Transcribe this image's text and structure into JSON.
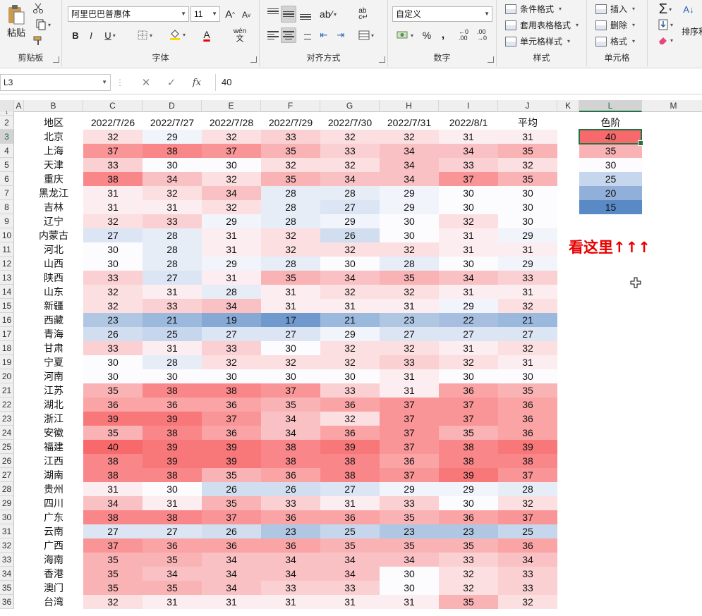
{
  "ribbon": {
    "clipboard": {
      "paste_label": "粘贴",
      "group_label": "剪贴板"
    },
    "font": {
      "name": "阿里巴巴普惠体",
      "size": "11",
      "group_label": "字体",
      "bold": "B",
      "italic": "I",
      "underline": "U",
      "grow": "A",
      "shrink": "A",
      "font_color": "A",
      "phonetic": "wén"
    },
    "alignment": {
      "group_label": "对齐方式"
    },
    "number": {
      "format": "自定义",
      "group_label": "数字",
      "percent": "%",
      "comma": ","
    },
    "styles": {
      "group_label": "样式",
      "items": [
        "条件格式",
        "套用表格格式",
        "单元格样式"
      ]
    },
    "cells": {
      "group_label": "单元格",
      "items": [
        "插入",
        "删除",
        "格式"
      ]
    },
    "editing": {
      "sort_label": "排序和"
    }
  },
  "formula_bar": {
    "name_box": "L3",
    "value": "40",
    "fx": "fx"
  },
  "columns": [
    "A",
    "B",
    "C",
    "D",
    "E",
    "F",
    "G",
    "H",
    "I",
    "J",
    "K",
    "L",
    "M"
  ],
  "table": {
    "headers": [
      "地区",
      "2022/7/26",
      "2022/7/27",
      "2022/7/28",
      "2022/7/29",
      "2022/7/30",
      "2022/7/31",
      "2022/8/1",
      "平均"
    ],
    "rows": [
      [
        "北京",
        32,
        29,
        32,
        33,
        32,
        32,
        31,
        31
      ],
      [
        "上海",
        37,
        38,
        37,
        35,
        33,
        34,
        34,
        35
      ],
      [
        "天津",
        33,
        30,
        30,
        32,
        32,
        34,
        33,
        32
      ],
      [
        "重庆",
        38,
        34,
        32,
        35,
        34,
        34,
        37,
        35
      ],
      [
        "黑龙江",
        31,
        32,
        34,
        28,
        28,
        29,
        30,
        30
      ],
      [
        "吉林",
        31,
        31,
        32,
        28,
        27,
        29,
        30,
        30
      ],
      [
        "辽宁",
        32,
        33,
        29,
        28,
        29,
        30,
        32,
        30
      ],
      [
        "内蒙古",
        27,
        28,
        31,
        32,
        26,
        30,
        31,
        29
      ],
      [
        "河北",
        30,
        28,
        31,
        32,
        32,
        32,
        31,
        31
      ],
      [
        "山西",
        30,
        28,
        29,
        28,
        30,
        28,
        30,
        29
      ],
      [
        "陕西",
        33,
        27,
        31,
        35,
        34,
        35,
        34,
        33
      ],
      [
        "山东",
        32,
        31,
        28,
        31,
        32,
        32,
        31,
        31
      ],
      [
        "新疆",
        32,
        33,
        34,
        31,
        31,
        31,
        29,
        32
      ],
      [
        "西藏",
        23,
        21,
        19,
        17,
        21,
        23,
        22,
        21
      ],
      [
        "青海",
        26,
        25,
        27,
        27,
        29,
        27,
        27,
        27
      ],
      [
        "甘肃",
        33,
        31,
        33,
        30,
        32,
        32,
        31,
        32
      ],
      [
        "宁夏",
        30,
        28,
        32,
        32,
        32,
        33,
        32,
        31
      ],
      [
        "河南",
        30,
        30,
        30,
        30,
        30,
        31,
        30,
        30
      ],
      [
        "江苏",
        35,
        38,
        38,
        37,
        33,
        31,
        36,
        35
      ],
      [
        "湖北",
        36,
        36,
        36,
        35,
        36,
        37,
        37,
        36
      ],
      [
        "浙江",
        39,
        39,
        37,
        34,
        32,
        37,
        37,
        36
      ],
      [
        "安徽",
        35,
        38,
        36,
        34,
        36,
        37,
        35,
        36
      ],
      [
        "福建",
        40,
        39,
        39,
        38,
        39,
        37,
        38,
        39
      ],
      [
        "江西",
        38,
        39,
        39,
        38,
        38,
        36,
        38,
        38
      ],
      [
        "湖南",
        38,
        38,
        35,
        36,
        38,
        37,
        39,
        37
      ],
      [
        "贵州",
        31,
        30,
        26,
        26,
        27,
        29,
        29,
        28
      ],
      [
        "四川",
        34,
        31,
        35,
        33,
        31,
        33,
        30,
        32
      ],
      [
        "广东",
        38,
        38,
        37,
        36,
        36,
        35,
        36,
        37
      ],
      [
        "云南",
        27,
        27,
        26,
        23,
        25,
        23,
        23,
        25
      ],
      [
        "广西",
        37,
        36,
        36,
        36,
        35,
        35,
        35,
        36
      ],
      [
        "海南",
        35,
        35,
        34,
        34,
        34,
        34,
        33,
        34
      ],
      [
        "香港",
        35,
        34,
        34,
        34,
        34,
        30,
        32,
        33
      ],
      [
        "澳门",
        35,
        35,
        34,
        33,
        33,
        30,
        32,
        33
      ],
      [
        "台湾",
        32,
        31,
        31,
        31,
        31,
        31,
        35,
        32
      ]
    ]
  },
  "scale": {
    "header": "色阶",
    "values": [
      40,
      35,
      30,
      25,
      20,
      15
    ]
  },
  "note": "看这里↑↑↑",
  "colors": {
    "hot": "#f8696b",
    "mid": "#fcfcff",
    "cold": "#5a8ac6",
    "accent": "#217346"
  }
}
